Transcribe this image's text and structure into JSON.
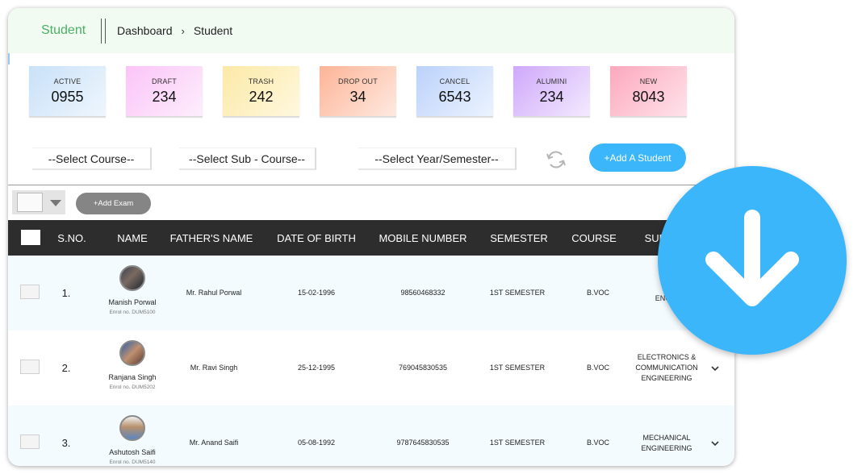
{
  "header": {
    "title": "Student",
    "breadcrumb": [
      "Dashboard",
      "Student"
    ]
  },
  "stats": [
    {
      "label": "ACTIVE",
      "value": "0955",
      "color_from": "#c9e1f8",
      "color_to": "#eef6fd"
    },
    {
      "label": "DRAFT",
      "value": "234",
      "color_from": "#fcc4f8",
      "color_to": "#fdeefc"
    },
    {
      "label": "TRASH",
      "value": "242",
      "color_from": "#fbe9a6",
      "color_to": "#fff8df"
    },
    {
      "label": "DROP OUT",
      "value": "34",
      "color_from": "#fdb497",
      "color_to": "#fee9e0"
    },
    {
      "label": "CANCEL",
      "value": "6543",
      "color_from": "#bcd2fb",
      "color_to": "#ebf3fe"
    },
    {
      "label": "ALUMINI",
      "value": "234",
      "color_from": "#cfa8fb",
      "color_to": "#f3eafe"
    },
    {
      "label": "NEW",
      "value": "8043",
      "color_from": "#fda8bd",
      "color_to": "#fee3ea"
    }
  ],
  "filters": {
    "course": "--Select Course--",
    "sub_course": "--Select Sub - Course--",
    "year_semester": "--Select Year/Semester--",
    "add_student": "+Add A Student"
  },
  "toolbar": {
    "add_exam": "+Add Exam"
  },
  "table": {
    "columns": [
      "S.NO.",
      "NAME",
      "FATHER'S NAME",
      "DATE OF BIRTH",
      "MOBILE NUMBER",
      "SEMESTER",
      "COURSE",
      "SUB"
    ],
    "rows": [
      {
        "sno": "1.",
        "name": "Manish Porwal",
        "enrol": "Enrol no. DUM5100",
        "father": "Mr. Rahul Porwal",
        "dob": "15-02-1996",
        "mobile": "98560468332",
        "semester": "1ST SEMESTER",
        "course": "B.VOC",
        "subject": "C\nENGIN"
      },
      {
        "sno": "2.",
        "name": "Ranjana Singh",
        "enrol": "Enrol no. DUM5202",
        "father": "Mr. Ravi Singh",
        "dob": "25-12-1995",
        "mobile": "769045830535",
        "semester": "1ST SEMESTER",
        "course": "B.VOC",
        "subject": "ELECTRONICS &\nCOMMUNICATION\nENGINEERING"
      },
      {
        "sno": "3.",
        "name": "Ashutosh Saifi",
        "enrol": "Enrol no. DUM5140",
        "father": "Mr. Anand Saifi",
        "dob": "05-08-1992",
        "mobile": "9787645830535",
        "semester": "1ST SEMESTER",
        "course": "B.VOC",
        "subject": "MECHANICAL\nENGINEERING"
      }
    ]
  },
  "icons": {
    "refresh": "refresh-icon",
    "download": "download-arrow-icon",
    "row_expand": "chevron-down-icon"
  },
  "colors": {
    "accent": "#3bb6fb",
    "header_bg": "#f1fbf2",
    "title_green": "#4caf65",
    "table_header": "#2d2d2d"
  }
}
